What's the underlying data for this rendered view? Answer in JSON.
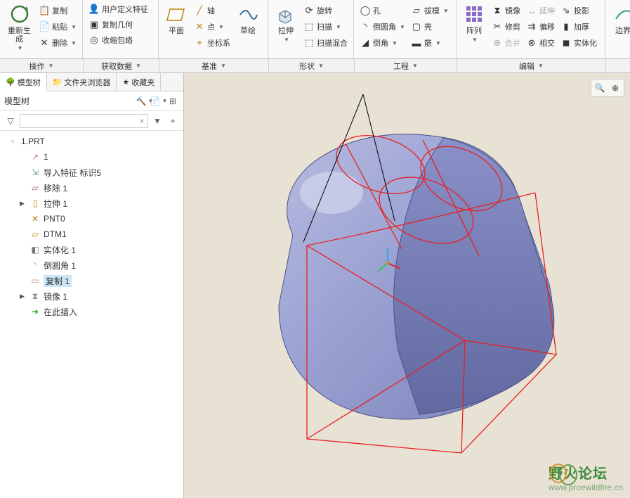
{
  "ribbon": {
    "groups": {
      "operate": {
        "regen": "重新生成",
        "copy": "复制",
        "paste": "粘贴",
        "delete": "删除"
      },
      "data": {
        "udf": "用户定义特征",
        "copygeom": "复制几何",
        "shrink": "收缩包络"
      },
      "datum": {
        "plane": "平面",
        "axis": "轴",
        "point": "点",
        "csys": "坐标系",
        "sketch": "草绘"
      },
      "shape": {
        "extrude": "拉伸",
        "revolve": "旋转",
        "sweep": "扫描",
        "blend": "扫描混合"
      },
      "eng": {
        "hole": "孔",
        "round": "倒圆角",
        "chamfer": "倒角",
        "draft": "拔模",
        "shell": "壳",
        "rib": "筋"
      },
      "edit": {
        "pattern": "阵列",
        "mirror": "镜像",
        "trim": "修剪",
        "merge": "合并",
        "extend": "延伸",
        "offset": "偏移",
        "intersect": "相交",
        "project": "投影",
        "thicken": "加厚",
        "solidify": "实体化"
      },
      "surf": {
        "bound": "边界"
      }
    },
    "labels": {
      "operate": "操作",
      "data": "获取数据",
      "datum": "基准",
      "shape": "形状",
      "eng": "工程",
      "edit": "编辑"
    }
  },
  "panel": {
    "tabs": {
      "tree": "模型树",
      "folder": "文件夹浏览器",
      "fav": "收藏夹"
    },
    "title": "模型树"
  },
  "tree": {
    "root": "1.PRT",
    "items": [
      {
        "label": "1",
        "icon": "csys"
      },
      {
        "label": "导入特征 标识5",
        "icon": "import"
      },
      {
        "label": "移除 1",
        "icon": "remove"
      },
      {
        "label": "拉伸 1",
        "icon": "extrude",
        "expand": true
      },
      {
        "label": "PNT0",
        "icon": "point"
      },
      {
        "label": "DTM1",
        "icon": "plane"
      },
      {
        "label": "实体化 1",
        "icon": "solidify"
      },
      {
        "label": "倒圆角 1",
        "icon": "round"
      },
      {
        "label": "复制 1",
        "icon": "copy",
        "selected": true
      },
      {
        "label": "镜像 1",
        "icon": "mirror",
        "expand": true
      },
      {
        "label": "在此插入",
        "icon": "insert"
      }
    ]
  },
  "watermark": {
    "title": "野火论坛",
    "url": "www.proewildfire.cn"
  }
}
